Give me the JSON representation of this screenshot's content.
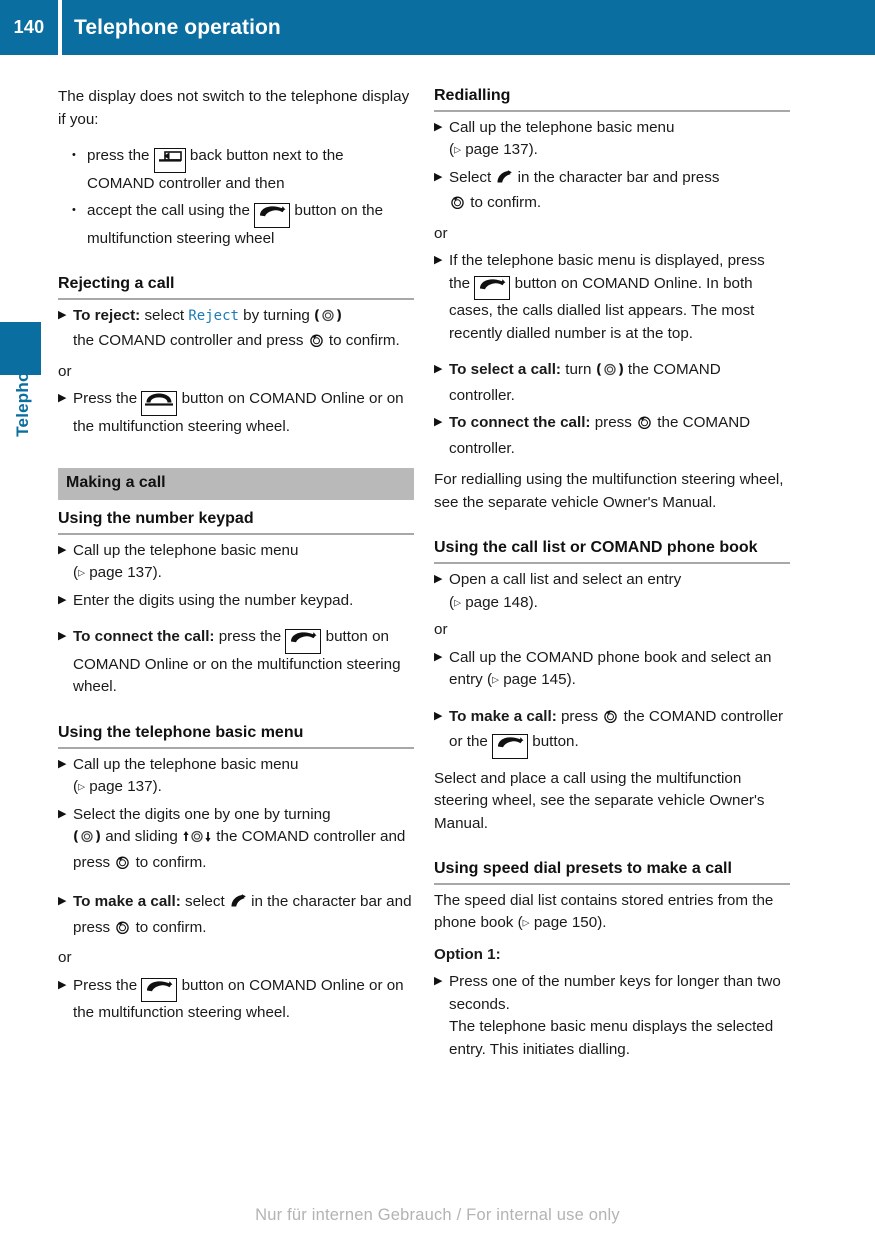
{
  "header": {
    "page_number": "140",
    "title": "Telephone operation"
  },
  "side_tab": {
    "label": "Telephone"
  },
  "left_column": {
    "intro": "The display does not switch to the telephone display if you:",
    "bullets": [
      {
        "pre": "press the ",
        "icon": "back-button-icon",
        "post": " back button next to the COMAND controller and then"
      },
      {
        "pre": "accept the call using the ",
        "icon": "phone-accept-button-icon",
        "post": " button on the multifunction steering wheel"
      }
    ],
    "rejecting": {
      "heading": "Rejecting a call",
      "step1_lead": "To reject:",
      "step1_a": " select ",
      "step1_menu": "Reject",
      "step1_b": " by turning ",
      "step1_c": " the COMAND controller and press ",
      "step1_d": " to confirm.",
      "or": "or",
      "step2_a": "Press the ",
      "step2_b": " button on COMAND Online or on the multifunction steering wheel."
    },
    "making_a_call": {
      "band": "Making a call",
      "keypad": {
        "heading": "Using the number keypad",
        "step1": "Call up the telephone basic menu",
        "step1_ref": "page 137",
        "step2": "Enter the digits using the number keypad.",
        "step3_lead": "To connect the call:",
        "step3_a": " press the ",
        "step3_b": " button on COMAND Online or on the multifunction steering wheel."
      },
      "basic_menu": {
        "heading": "Using the telephone basic menu",
        "step1": "Call up the telephone basic menu",
        "step1_ref": "page 137",
        "step2_a": "Select the digits one by one by turning ",
        "step2_b": " and sliding ",
        "step2_c": " the COMAND controller and press ",
        "step2_d": " to confirm.",
        "step3_lead": "To make a call:",
        "step3_a": " select ",
        "step3_b": " in the character bar and press ",
        "step3_c": " to confirm.",
        "or": "or",
        "step4_a": "Press the ",
        "step4_b": " button on COMAND Online or on the multifunction steering wheel."
      }
    }
  },
  "right_column": {
    "redialling": {
      "heading": "Redialling",
      "step1": "Call up the telephone basic menu",
      "step1_ref": "page 137",
      "step2_a": "Select ",
      "step2_b": " in the character bar and press ",
      "step2_c": " to confirm.",
      "or": "or",
      "step3_a": "If the telephone basic menu is displayed, press the ",
      "step3_b": " button on COMAND Online. In both cases, the calls dialled list appears. The most recently dialled number is at the top.",
      "step4_lead": "To select a call:",
      "step4_a": " turn ",
      "step4_b": " the COMAND controller.",
      "step5_lead": "To connect the call:",
      "step5_a": " press ",
      "step5_b": " the COMAND controller.",
      "note": "For redialling using the multifunction steering wheel, see the separate vehicle Owner's Manual."
    },
    "call_list": {
      "heading": "Using the call list or COMAND phone book",
      "step1": "Open a call list and select an entry",
      "step1_ref": "page 148",
      "or": "or",
      "step2_a": "Call up the COMAND phone book and select an entry (",
      "step2_ref": "page 145",
      "step2_b": ").",
      "step3_lead": "To make a call:",
      "step3_a": " press ",
      "step3_b": " the COMAND controller or the ",
      "step3_c": " button.",
      "note": "Select and place a call using the multifunction steering wheel, see the separate vehicle Owner's Manual."
    },
    "speed_dial": {
      "heading": "Using speed dial presets to make a call",
      "intro_a": "The speed dial list contains stored entries from the phone book (",
      "intro_ref": "page 150",
      "intro_b": ").",
      "option_label": "Option 1:",
      "step1": "Press one of the number keys for longer than two seconds.",
      "step1_cont": "The telephone basic menu displays the selected entry. This initiates dialling."
    }
  },
  "footer": {
    "watermark": "Nur für internen Gebrauch / For internal use only"
  },
  "colors": {
    "header_blue": "#0a6ea0",
    "band_gray": "#b9b9b9",
    "menu_blue": "#1b7bb5",
    "rule_gray": "#a8a8a8"
  }
}
